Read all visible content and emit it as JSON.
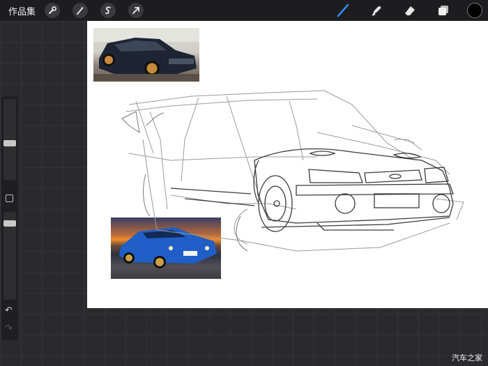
{
  "topbar": {
    "gallery_label": "作品集",
    "left_tools": [
      "wrench-icon",
      "magic-wand-icon",
      "selection-icon",
      "transform-arrow-icon"
    ],
    "right_tools": [
      "brush-icon",
      "smudge-icon",
      "eraser-icon",
      "layers-icon"
    ],
    "active_tool": "brush-icon",
    "accent_color": "#2f8cf0",
    "current_color": "#000000"
  },
  "sidebar": {
    "brush_size_level": 0.45,
    "opacity_level": 0.2,
    "undo_icon": "undo-icon",
    "redo_icon": "redo-icon"
  },
  "canvas": {
    "background": "#ffffff",
    "reference_images": [
      "dark-blue-subaru-model-car-photo",
      "blue-subaru-sunset-photo"
    ],
    "sketch": "car-line-drawing"
  },
  "watermark": "汽车之家"
}
